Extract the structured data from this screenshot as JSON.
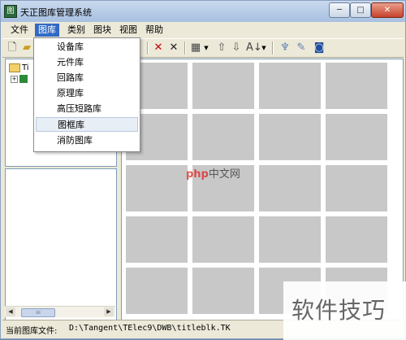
{
  "window": {
    "title": "天正图库管理系统",
    "controls": {
      "minimize": "─",
      "maximize": "□",
      "close": "✕"
    }
  },
  "menubar": {
    "items": [
      "文件",
      "图库",
      "类别",
      "图块",
      "视图",
      "帮助"
    ],
    "active_index": 1
  },
  "toolbar": {
    "icons": [
      "new-icon",
      "open-folder-icon",
      "delete-icon",
      "cross-icon",
      "view-grid-icon",
      "up-arrow-icon",
      "down-arrow-icon",
      "sort-icon",
      "pin-icon",
      "edit-icon",
      "window-icon"
    ]
  },
  "dropdown": {
    "items": [
      "设备库",
      "元件库",
      "回路库",
      "原理库",
      "高压短路库",
      "图框库",
      "消防图库"
    ],
    "hover_index": 5
  },
  "tree": {
    "root_label": "Ti",
    "child_expand": "+"
  },
  "grid": {
    "rows": 5,
    "cols": 4
  },
  "status": {
    "label": "当前图库文件:",
    "path": "D:\\Tangent\\TElec9\\DWB\\titleblk.TK"
  },
  "watermark": {
    "logo": "php",
    "text": "中文网"
  },
  "corner_watermark": "软件技巧",
  "colors": {
    "menu_active": "#316ac5",
    "grid_cell": "#c8c8c8",
    "delete_red": "#c00000"
  }
}
